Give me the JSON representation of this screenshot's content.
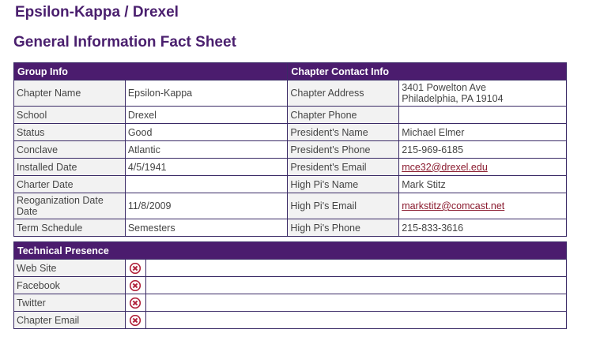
{
  "page": {
    "title": "Epsilon-Kappa / Drexel",
    "subtitle": "General Information Fact Sheet"
  },
  "group_info": {
    "header": "Group Info",
    "rows": [
      {
        "label": "Chapter Name",
        "value": "Epsilon-Kappa"
      },
      {
        "label": "School",
        "value": "Drexel"
      },
      {
        "label": "Status",
        "value": "Good"
      },
      {
        "label": "Conclave",
        "value": "Atlantic"
      },
      {
        "label": "Installed Date",
        "value": "4/5/1941"
      },
      {
        "label": "Charter Date",
        "value": ""
      },
      {
        "label": "Reoganization Date Date",
        "value": "11/8/2009"
      },
      {
        "label": "Term Schedule",
        "value": "Semesters"
      }
    ]
  },
  "chapter_contact": {
    "header": "Chapter Contact Info",
    "rows": [
      {
        "label": "Chapter Address",
        "value": "3401 Powelton Ave",
        "value2": "Philadelphia, PA 19104"
      },
      {
        "label": "Chapter Phone",
        "value": ""
      },
      {
        "label": "President's Name",
        "value": "Michael Elmer"
      },
      {
        "label": "President's Phone",
        "value": "215-969-6185"
      },
      {
        "label": "President's Email",
        "value": "mce32@drexel.edu"
      },
      {
        "label": "High Pi's Name",
        "value": "Mark Stitz"
      },
      {
        "label": "High Pi's Email",
        "value": "markstitz@comcast.net"
      },
      {
        "label": "High Pi's Phone",
        "value": "215-833-3616"
      }
    ]
  },
  "technical_presence": {
    "header": "Technical Presence",
    "rows": [
      {
        "label": "Web Site",
        "icon": "not-available-icon",
        "value": ""
      },
      {
        "label": "Facebook",
        "icon": "not-available-icon",
        "value": ""
      },
      {
        "label": "Twitter",
        "icon": "not-available-icon",
        "value": ""
      },
      {
        "label": "Chapter Email",
        "icon": "not-available-icon",
        "value": ""
      }
    ]
  },
  "colors": {
    "header_bg": "#4b1c6e",
    "title": "#4a1f6e",
    "link": "#8a1a2e",
    "icon": "#b0203a"
  }
}
